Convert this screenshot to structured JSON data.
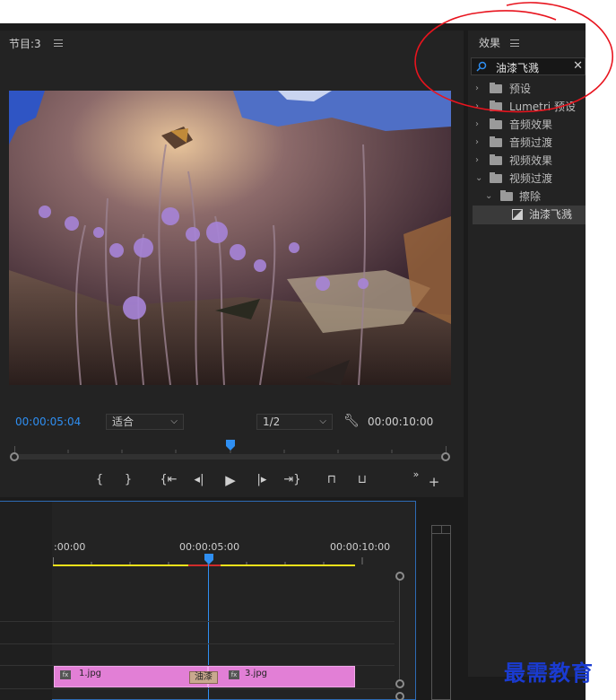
{
  "program_monitor": {
    "title": "节目:3",
    "current_timecode": "00:00:05:04",
    "fit_option": "适合",
    "resolution": "1/2",
    "duration_timecode": "00:00:10:00",
    "playhead_fraction": 0.5,
    "colors": {
      "timecode_blue": "#2f8ff2",
      "panel_bg": "#232323"
    }
  },
  "effects_panel": {
    "title": "效果",
    "search_value": "油漆飞溅",
    "tree": [
      {
        "label": "预设",
        "kind": "preset-folder",
        "expanded": false,
        "depth": 0
      },
      {
        "label": "Lumetri 预设",
        "kind": "preset-folder",
        "expanded": false,
        "depth": 0
      },
      {
        "label": "音频效果",
        "kind": "folder",
        "expanded": false,
        "depth": 0
      },
      {
        "label": "音频过渡",
        "kind": "folder",
        "expanded": false,
        "depth": 0
      },
      {
        "label": "视频效果",
        "kind": "folder",
        "expanded": false,
        "depth": 0
      },
      {
        "label": "视频过渡",
        "kind": "folder",
        "expanded": true,
        "depth": 0
      },
      {
        "label": "擦除",
        "kind": "folder",
        "expanded": true,
        "depth": 1
      },
      {
        "label": "油漆飞溅",
        "kind": "transition",
        "selected": true,
        "depth": 2
      }
    ]
  },
  "timeline": {
    "ruler_labels": [
      ":00:00",
      "00:00:05:00",
      "00:00:10:00"
    ],
    "clips": [
      {
        "name": "1.jpg",
        "color": "#e27fd6"
      },
      {
        "name": "3.jpg",
        "color": "#e27fd6"
      }
    ],
    "transition_label": "油漆",
    "colors": {
      "work_area": "#f2e21a",
      "playhead": "#2f8ff2",
      "render_bar": "#d02c2c"
    }
  },
  "watermark": {
    "text": "最需教育",
    "color": "#1a3bd1"
  }
}
